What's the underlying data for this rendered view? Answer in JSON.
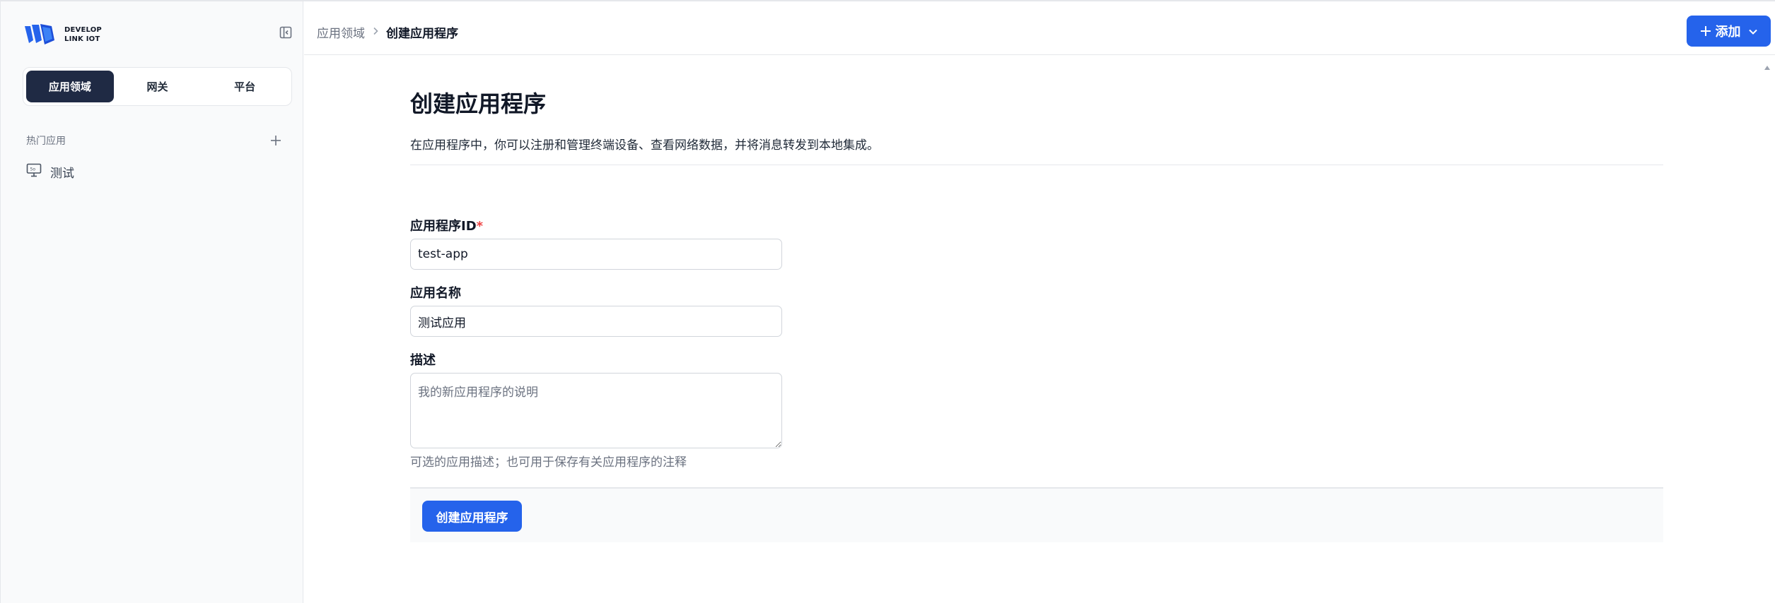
{
  "brand": {
    "line1": "DEVELOP",
    "line2": "LINK IOT",
    "accent_color": "#2563eb"
  },
  "sidebar": {
    "segments": [
      {
        "label": "应用领域",
        "active": true
      },
      {
        "label": "网关",
        "active": false
      },
      {
        "label": "平台",
        "active": false
      }
    ],
    "section_label": "热门应用",
    "items": [
      {
        "label": "测试",
        "icon": "monitor-icon"
      }
    ]
  },
  "header": {
    "breadcrumb": {
      "parent": "应用领域",
      "current": "创建应用程序"
    },
    "add_label": "添加"
  },
  "main": {
    "title": "创建应用程序",
    "description": "在应用程序中，你可以注册和管理终端设备、查看网络数据，并将消息转发到本地集成。",
    "fields": {
      "app_id": {
        "label": "应用程序ID",
        "required_mark": "*",
        "value": "test-app"
      },
      "app_name": {
        "label": "应用名称",
        "value": "测试应用"
      },
      "description": {
        "label": "描述",
        "placeholder": "我的新应用程序的说明",
        "hint": "可选的应用描述；也可用于保存有关应用程序的注释"
      }
    },
    "submit_label": "创建应用程序"
  }
}
